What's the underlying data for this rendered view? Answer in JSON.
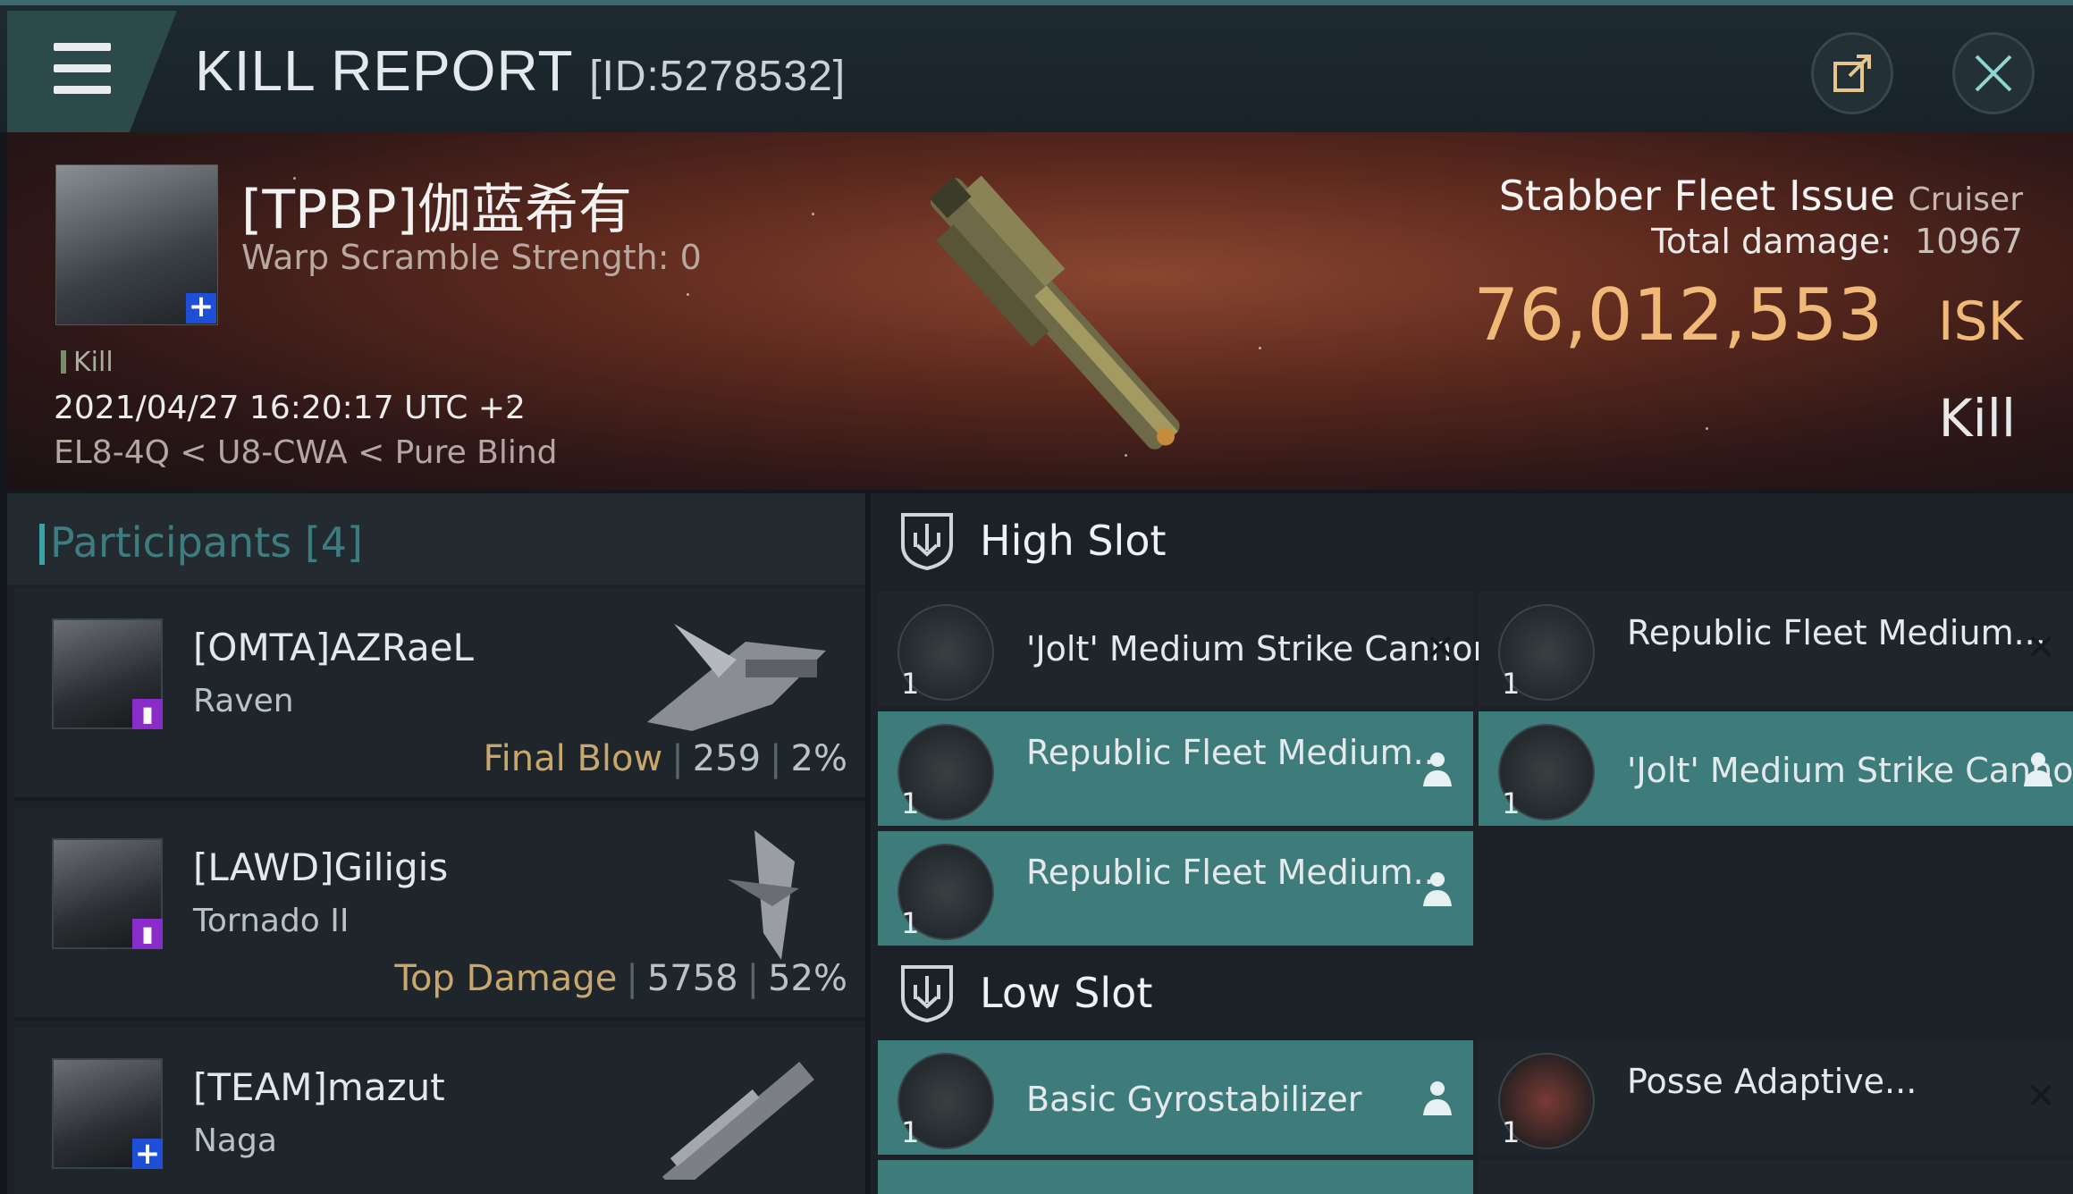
{
  "header": {
    "title": "KILL REPORT",
    "report_id": "[ID:5278532]",
    "share_icon": "share-icon",
    "close_icon": "close-icon"
  },
  "victim": {
    "name": "[TPBP]伽蓝希有",
    "warp_scramble": "Warp Scramble Strength: 0",
    "kill_tag": "Kill",
    "datetime": "2021/04/27 16:20:17 UTC +2",
    "location": "EL8-4Q < U8-CWA < Pure Blind",
    "ship_name": "Stabber Fleet Issue",
    "ship_class": "Cruiser",
    "total_damage_label": "Total damage:",
    "total_damage_value": "10967",
    "isk_value": "76,012,553",
    "isk_unit": "ISK",
    "result_label": "Kill"
  },
  "participants": {
    "title": "Participants [4]",
    "rows": [
      {
        "name": "[OMTA]AZRaeL",
        "ship": "Raven",
        "stat_label": "Final Blow",
        "damage": "259",
        "percent": "2%"
      },
      {
        "name": "[LAWD]Giligis",
        "ship": "Tornado II",
        "stat_label": "Top Damage",
        "damage": "5758",
        "percent": "52%"
      },
      {
        "name": "[TEAM]mazut",
        "ship": "Naga"
      }
    ]
  },
  "slots": {
    "high": {
      "label": "High Slot",
      "items": [
        {
          "name": "'Jolt' Medium Strike Cannon",
          "qty": "1"
        },
        {
          "name": "Republic Fleet Medium...",
          "qty": "1"
        },
        {
          "name": "Republic Fleet Medium...",
          "qty": "1"
        },
        {
          "name": "'Jolt' Medium Strike Cannon",
          "qty": "1"
        },
        {
          "name": "Republic Fleet Medium...",
          "qty": "1"
        }
      ]
    },
    "low": {
      "label": "Low Slot",
      "items": [
        {
          "name": "Basic Gyrostabilizer",
          "qty": "1"
        },
        {
          "name": "Posse Adaptive...",
          "qty": "1"
        }
      ]
    }
  },
  "colors": {
    "accent": "#3e7c7c",
    "isk": "#f0b977",
    "stat_label": "#c9a66c"
  }
}
